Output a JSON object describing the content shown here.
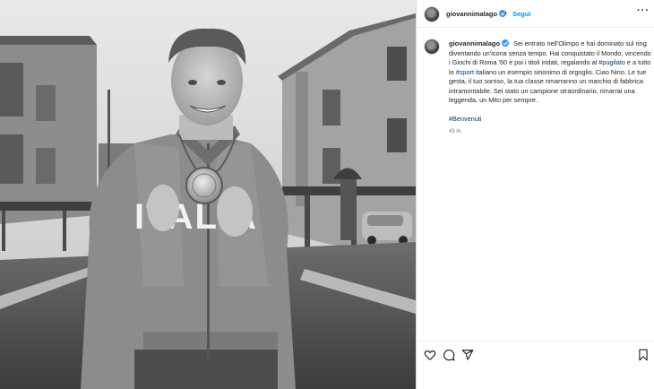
{
  "post": {
    "author": "giovannimalago",
    "follow_label": "Segui",
    "separator": "•",
    "more_label": "···",
    "caption_line1_a": "Sei entrato nell'Olimpo e hai dominato sul ring diventando un'icona senza tempo. Hai conquistato il Mondo, vincendo i Giochi di Roma '60 e poi i titoli iridati, regalando al ",
    "hashtag_pugilato": "#pugilato",
    "caption_line1_b": " e a tutto lo ",
    "hashtag_sport": "#sport",
    "caption_line1_c": " italiano un esempio sinonimo di orgoglio. Ciao Nino. Le tue gesta, il tuo sorriso, la tua classe rimarranno un marchio di fabbrica intramontabile. Sei stato un campione straordinario, rimarrai una leggenda, un Mito per sempre.",
    "hashtag_benvenuti": "#Benvenuti",
    "timestamp": "43 m"
  },
  "photo": {
    "jacket_lettering": "ITALIA"
  },
  "actions": {
    "icons": [
      "heart-icon",
      "comment-icon",
      "share-icon",
      "bookmark-icon"
    ]
  },
  "colors": {
    "link_blue": "#0095f6",
    "hashtag": "#00376b",
    "verified_blue": "#3897f0"
  }
}
